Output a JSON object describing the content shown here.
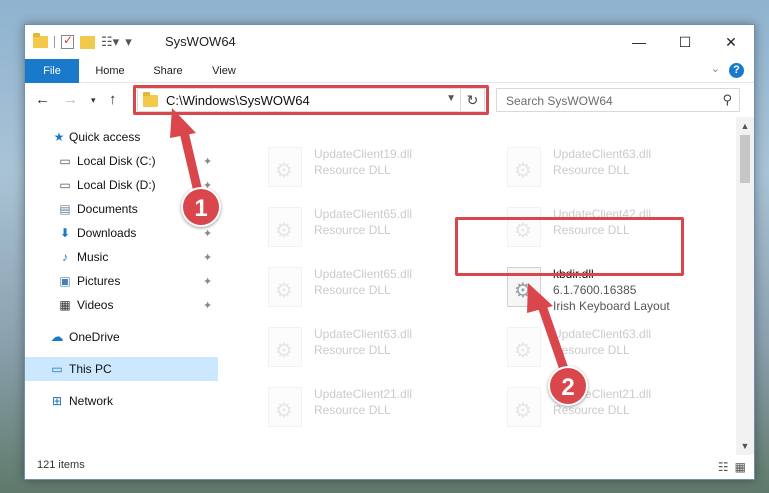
{
  "window": {
    "title": "SysWOW64",
    "controls": {
      "minimize": "—",
      "maximize": "☐",
      "close": "✕"
    }
  },
  "ribbon": {
    "tabs": [
      "File",
      "Home",
      "Share",
      "View"
    ],
    "help": "?"
  },
  "nav": {
    "address": "C:\\Windows\\SysWOW64",
    "search_placeholder": "Search SysWOW64"
  },
  "sidebar": {
    "items": [
      {
        "label": "Quick access",
        "icon": "star-icon",
        "pinned": false
      },
      {
        "label": "Local Disk (C:)",
        "icon": "drive-icon",
        "pinned": true
      },
      {
        "label": "Local Disk (D:)",
        "icon": "drive-icon",
        "pinned": true
      },
      {
        "label": "Documents",
        "icon": "documents-icon",
        "pinned": true
      },
      {
        "label": "Downloads",
        "icon": "download-icon",
        "pinned": true
      },
      {
        "label": "Music",
        "icon": "music-icon",
        "pinned": true
      },
      {
        "label": "Pictures",
        "icon": "pictures-icon",
        "pinned": true
      },
      {
        "label": "Videos",
        "icon": "videos-icon",
        "pinned": true
      },
      {
        "label": "OneDrive",
        "icon": "cloud-icon",
        "pinned": false
      },
      {
        "label": "This PC",
        "icon": "computer-icon",
        "pinned": false,
        "selected": true
      },
      {
        "label": "Network",
        "icon": "network-icon",
        "pinned": false
      }
    ]
  },
  "files": [
    {
      "name": "UpdateClient19.dll",
      "type": "Resource DLL"
    },
    {
      "name": "UpdateClient63.dll",
      "type": "Resource DLL"
    },
    {
      "name": "UpdateClient65.dll",
      "type": "Resource DLL"
    },
    {
      "name": "UpdateClient42.dll",
      "type": "Resource DLL"
    },
    {
      "name": "UpdateClient65.dll",
      "type": "Resource DLL"
    },
    {
      "name": "kbdir.dll",
      "version": "6.1.7600.16385",
      "type": "Irish Keyboard Layout"
    },
    {
      "name": "UpdateClient63.dll",
      "type": "Resource DLL"
    },
    {
      "name": "UpdateClient63.dll",
      "type": "Resource DLL"
    },
    {
      "name": "UpdateClient21.dll",
      "type": "Resource DLL"
    },
    {
      "name": "UpdateClient21.dll",
      "type": "Resource DLL"
    }
  ],
  "status": {
    "item_count": "121 items"
  },
  "callouts": {
    "step1": "1",
    "step2": "2"
  },
  "colors": {
    "accent": "#1979ca",
    "highlight": "#d9474d",
    "selection": "#cce8ff"
  }
}
